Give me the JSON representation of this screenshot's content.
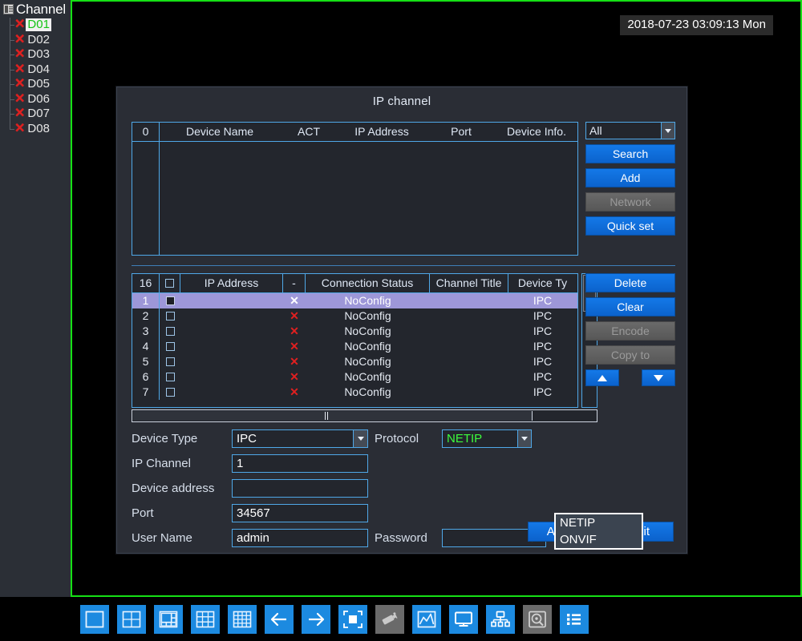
{
  "clock": "2018-07-23 03:09:13 Mon",
  "sidebar": {
    "title": "Channel",
    "tree_icon": "tree-node-icon",
    "channels": [
      {
        "label": "D01",
        "status_icon": "red-x-icon",
        "active": true
      },
      {
        "label": "D02",
        "status_icon": "red-x-icon",
        "active": false
      },
      {
        "label": "D03",
        "status_icon": "red-x-icon",
        "active": false
      },
      {
        "label": "D04",
        "status_icon": "red-x-icon",
        "active": false
      },
      {
        "label": "D05",
        "status_icon": "red-x-icon",
        "active": false
      },
      {
        "label": "D06",
        "status_icon": "red-x-icon",
        "active": false
      },
      {
        "label": "D07",
        "status_icon": "red-x-icon",
        "active": false
      },
      {
        "label": "D08",
        "status_icon": "red-x-icon",
        "active": false
      }
    ]
  },
  "dialog": {
    "title": "IP channel",
    "search_table": {
      "count": "0",
      "headers": [
        "Device Name",
        "ACT",
        "IP Address",
        "Port",
        "Device Info."
      ],
      "rows": []
    },
    "filter_select": {
      "value": "All"
    },
    "search_buttons": [
      {
        "label": "Search",
        "enabled": true
      },
      {
        "label": "Add",
        "enabled": true
      },
      {
        "label": "Network",
        "enabled": false
      },
      {
        "label": "Quick set",
        "enabled": true
      }
    ],
    "channel_table": {
      "count": "16",
      "headers": [
        "",
        "IP Address",
        "-",
        "Connection Status",
        "Channel Title",
        "Device Ty"
      ],
      "rows": [
        {
          "n": "1",
          "ip": "",
          "act_icon": "red-x-icon",
          "status": "NoConfig",
          "title": "",
          "type": "IPC",
          "selected": true
        },
        {
          "n": "2",
          "ip": "",
          "act_icon": "red-x-icon",
          "status": "NoConfig",
          "title": "",
          "type": "IPC",
          "selected": false
        },
        {
          "n": "3",
          "ip": "",
          "act_icon": "red-x-icon",
          "status": "NoConfig",
          "title": "",
          "type": "IPC",
          "selected": false
        },
        {
          "n": "4",
          "ip": "",
          "act_icon": "red-x-icon",
          "status": "NoConfig",
          "title": "",
          "type": "IPC",
          "selected": false
        },
        {
          "n": "5",
          "ip": "",
          "act_icon": "red-x-icon",
          "status": "NoConfig",
          "title": "",
          "type": "IPC",
          "selected": false
        },
        {
          "n": "6",
          "ip": "",
          "act_icon": "red-x-icon",
          "status": "NoConfig",
          "title": "",
          "type": "IPC",
          "selected": false
        },
        {
          "n": "7",
          "ip": "",
          "act_icon": "red-x-icon",
          "status": "NoConfig",
          "title": "",
          "type": "IPC",
          "selected": false
        }
      ]
    },
    "channel_buttons": [
      {
        "label": "Delete",
        "enabled": true
      },
      {
        "label": "Clear",
        "enabled": true
      },
      {
        "label": "Encode",
        "enabled": false
      },
      {
        "label": "Copy to",
        "enabled": false
      }
    ],
    "move_up_icon": "arrow-up-icon",
    "move_down_icon": "arrow-down-icon",
    "form": {
      "device_type": {
        "label": "Device Type",
        "value": "IPC"
      },
      "protocol": {
        "label": "Protocol",
        "value": "NETIP",
        "options": [
          "NETIP",
          "ONVIF"
        ],
        "open": true
      },
      "ip_channel": {
        "label": "IP Channel",
        "value": "1"
      },
      "device_address": {
        "label": "Device address",
        "value": ""
      },
      "port": {
        "label": "Port",
        "value": "34567"
      },
      "user_name": {
        "label": "User Name",
        "value": "admin"
      },
      "password": {
        "label": "Password",
        "value": "",
        "reveal_icon": "eye-slash-icon"
      }
    },
    "footer_buttons": [
      {
        "label": "Apply"
      },
      {
        "label": "Exit"
      }
    ]
  },
  "taskbar": {
    "items": [
      {
        "icon": "layout-1-icon",
        "enabled": true
      },
      {
        "icon": "layout-4-icon",
        "enabled": true
      },
      {
        "icon": "layout-6-icon",
        "enabled": true
      },
      {
        "icon": "layout-9-icon",
        "enabled": true
      },
      {
        "icon": "layout-16-icon",
        "enabled": true
      },
      {
        "icon": "arrow-left-icon",
        "enabled": true
      },
      {
        "icon": "arrow-right-icon",
        "enabled": true
      },
      {
        "icon": "fullscreen-icon",
        "enabled": true
      },
      {
        "icon": "ptz-camera-icon",
        "enabled": false
      },
      {
        "icon": "record-chart-icon",
        "enabled": true
      },
      {
        "icon": "monitor-icon",
        "enabled": true
      },
      {
        "icon": "network-tree-icon",
        "enabled": true
      },
      {
        "icon": "hdd-icon",
        "enabled": false
      },
      {
        "icon": "main-menu-list-icon",
        "enabled": true
      }
    ]
  },
  "colors": {
    "accent_blue": "#1479e8",
    "border_blue": "#4fa8e8",
    "selection_purple": "#9d97d8",
    "green_border": "#15e015",
    "active_green": "#3dfd3d",
    "error_red": "#e02020",
    "panel_bg": "#2a2d35"
  }
}
